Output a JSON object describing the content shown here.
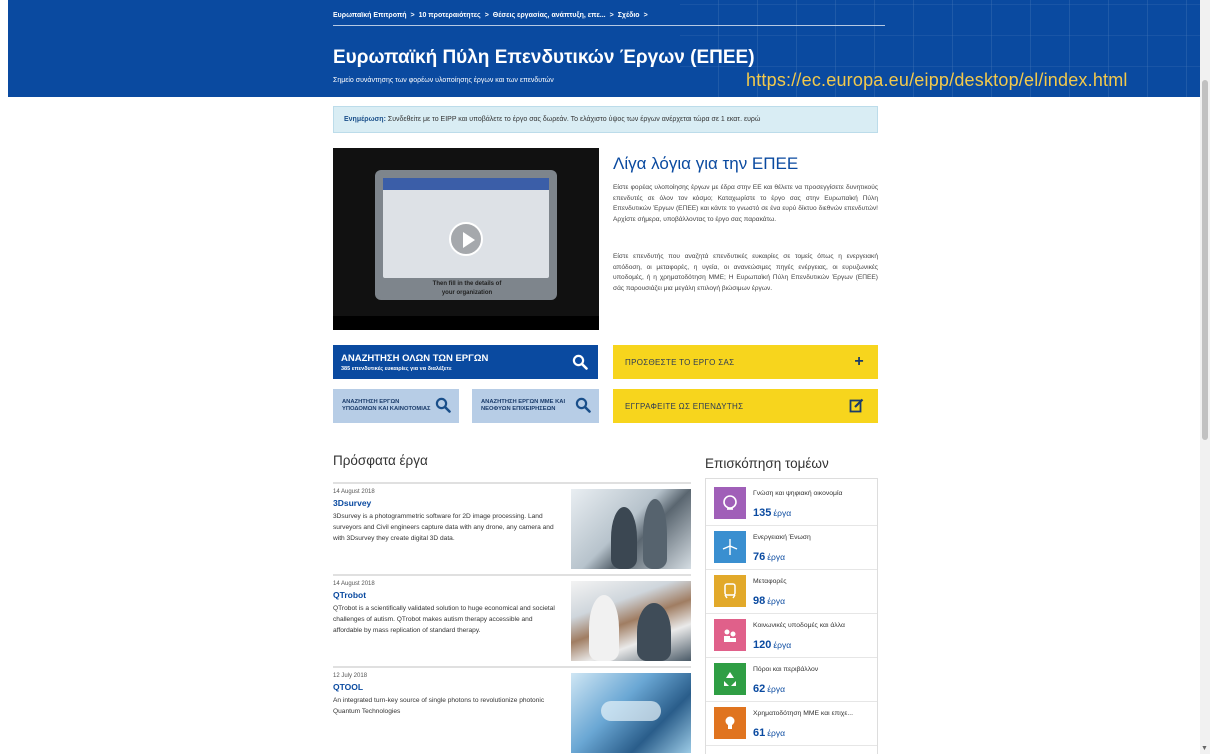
{
  "header": {
    "breadcrumb": [
      "Ευρωπαϊκή Επιτροπή",
      "10 προτεραιότητες",
      "Θέσεις εργασίας, ανάπτυξη, επε...",
      "Σχέδιο"
    ],
    "breadcrumb_sep": ">",
    "title": "Ευρωπαϊκή Πύλη Επενδυτικών Έργων (ΕΠΕΕ)",
    "subtitle": "Σημείο συνάντησης των φορέων υλοποίησης έργων και των επενδυτών",
    "url_overlay": "https://ec.europa.eu/eipp/desktop/el/index.html",
    "brand_color": "#0a4aa0",
    "url_color": "#f2c94c"
  },
  "notice": {
    "label": "Ενημέρωση:",
    "text": " Συνδεθείτε με το EIPP και υποβάλετε το έργο σας δωρεάν. Το ελάχιστο ύψος των έργων ανέρχεται τώρα σε 1 εκατ. ευρώ"
  },
  "video": {
    "caption": "Then fill in the details of your organization"
  },
  "about": {
    "title": "Λίγα λόγια για την ΕΠΕΕ",
    "p1": "Είστε φορέας υλοποίησης έργων με έδρα στην ΕΕ και θέλετε να προσεγγίσετε δυνητικούς επενδυτές σε όλον τον κόσμο; Καταχωρίστε το έργο σας στην Ευρωπαϊκή Πύλη Επενδυτικών Έργων (ΕΠΕΕ) και κάντε το γνωστό σε ένα ευρύ δίκτυο διεθνών επενδυτών! Αρχίστε σήμερα, υποβάλλοντας το έργο σας παρακάτω.",
    "p2": "Είστε επενδυτής που αναζητά επενδυτικές ευκαιρίες σε τομείς όπως η ενεργειακή απόδοση, οι μεταφορές, η υγεία, οι ανανεώσιμες πηγές ενέργειας, οι ευρυζωνικές υποδομές, ή η χρηματοδότηση ΜΜΕ; Η Ευρωπαϊκή Πύλη Επενδυτικών Έργων (ΕΠΕΕ) σάς παρουσιάζει μια μεγάλη επιλογή βιώσιμων έργων."
  },
  "actions": {
    "search_all": "ΑΝΑΖΗΤΗΣΗ ΟΛΩΝ ΤΩΝ ΕΡΓΩΝ",
    "search_all_sub": "385 επενδυτικές ευκαιρίες για να διαλέξετε",
    "search_infra_1": "ΑΝΑΖΗΤΗΣΗ ΕΡΓΩΝ",
    "search_infra_2": "ΥΠΟΔΟΜΩΝ ΚΑΙ ΚΑΙΝΟΤΟΜΙΑΣ",
    "search_sme_1": "ΑΝΑΖΗΤΗΣΗ ΕΡΓΩΝ ΜΜΕ ΚΑΙ",
    "search_sme_2": "ΝΕΟΦΥΩΝ ΕΠΙΧΕΙΡΗΣΕΩΝ",
    "add_project": "ΠΡΟΣΘΕΣΤΕ ΤΟ ΕΡΓΟ ΣΑΣ",
    "register_investor": "ΕΓΓΡΑΦΕΙΤΕ ΩΣ ΕΠΕΝΔΥΤΗΣ",
    "yellow_color": "#f7d51d"
  },
  "recent": {
    "title": "Πρόσφατα έργα",
    "projects": [
      {
        "date": "14 August 2018",
        "name": "3Dsurvey",
        "desc": "3Dsurvey is a photogrammetric software for 2D image processing. Land surveyors and Civil engineers capture data with any drone, any camera and with 3Dsurvey they create digital 3D data."
      },
      {
        "date": "14 August 2018",
        "name": "QTrobot",
        "desc": "QTrobot is a scientifically validated solution to huge economical and societal challenges of autism. QTrobot makes autism therapy accessible and affordable by mass replication of standard therapy."
      },
      {
        "date": "12 July 2018",
        "name": "QTOOL",
        "desc": "An integrated turn-key source of single photons to revolutionize photonic Quantum Technologies"
      }
    ]
  },
  "sectors": {
    "title": "Επισκόπηση τομέων",
    "unit": "έργα",
    "items": [
      {
        "label": "Γνώση και ψηφιακή οικονομία",
        "count": "135",
        "color": "#a05fb8",
        "icon": "brain-icon"
      },
      {
        "label": "Ενεργειακή Ένωση",
        "count": "76",
        "color": "#3a8fd0",
        "icon": "wind-turbine-icon"
      },
      {
        "label": "Μεταφορές",
        "count": "98",
        "color": "#e2a92a",
        "icon": "train-icon"
      },
      {
        "label": "Κοινωνικές υποδομές και άλλα",
        "count": "120",
        "color": "#e0608a",
        "icon": "people-icon"
      },
      {
        "label": "Πόροι και περιβάλλον",
        "count": "62",
        "color": "#2f9e44",
        "icon": "recycle-icon"
      },
      {
        "label": "Χρηματοδότηση ΜΜΕ και επιχε...",
        "count": "61",
        "color": "#e0741f",
        "icon": "lightbulb-icon"
      }
    ]
  }
}
